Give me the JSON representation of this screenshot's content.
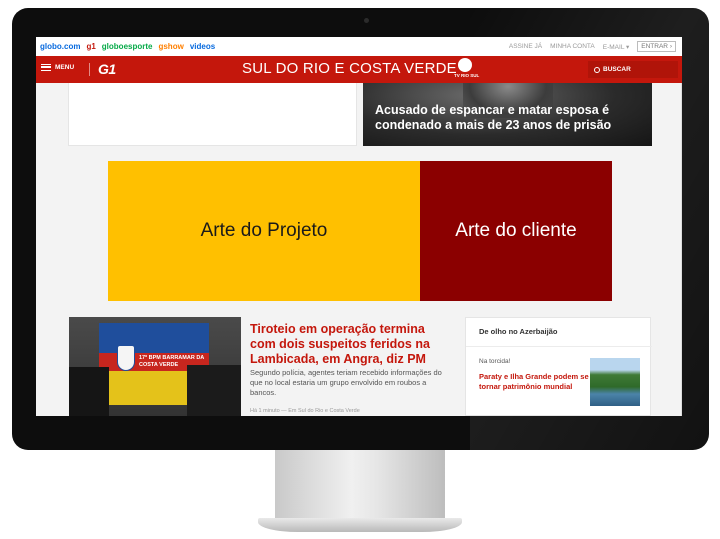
{
  "globo_bar": {
    "links": [
      {
        "label": "globo.com",
        "color": "#0669de"
      },
      {
        "label": "g1",
        "color": "#c4170c"
      },
      {
        "label": "globoesporte",
        "color": "#06aa48"
      },
      {
        "label": "gshow",
        "color": "#ff7f00"
      },
      {
        "label": "videos",
        "color": "#0669de"
      }
    ],
    "right": {
      "subscribe": "ASSINE JÁ",
      "account": "MINHA CONTA",
      "email": "E-MAIL",
      "enter": "ENTRAR"
    }
  },
  "g1_header": {
    "menu_label": "MENU",
    "logo": "G1",
    "region_title": "SUL DO RIO E COSTA VERDE",
    "region_logo_text": "TV RIO SUL",
    "search_label": "BUSCAR",
    "brand_color": "#c4170c"
  },
  "top_story": {
    "headline": "Acusado de espancar e matar esposa é condenado a mais de 23 anos de prisão"
  },
  "ad": {
    "project_label": "Arte do Projeto",
    "client_label": "Arte do cliente",
    "project_color": "#ffc000",
    "client_color": "#8b0000"
  },
  "news": {
    "photo_text": "17º BPM BARRAMAR DA COSTA VERDE",
    "title": "Tiroteio em operação termina com dois suspeitos feridos na Lambicada, em Angra, diz PM",
    "summary": "Segundo polícia, agentes teriam recebido informações do que no local estaria um grupo envolvido em roubos a bancos.",
    "meta": "Há 1 minuto — Em Sul do Rio e Costa Verde"
  },
  "sidebar": {
    "label": "De olho no Azerbaijão",
    "kicker": "Na torcida!",
    "title": "Paraty e Ilha Grande podem se tornar patrimônio mundial"
  },
  "icons": [
    "hamburger-menu-icon",
    "g1-logo",
    "tv-rio-sul-logo",
    "search-icon",
    "chevron-down-icon",
    "chevron-right-icon"
  ]
}
